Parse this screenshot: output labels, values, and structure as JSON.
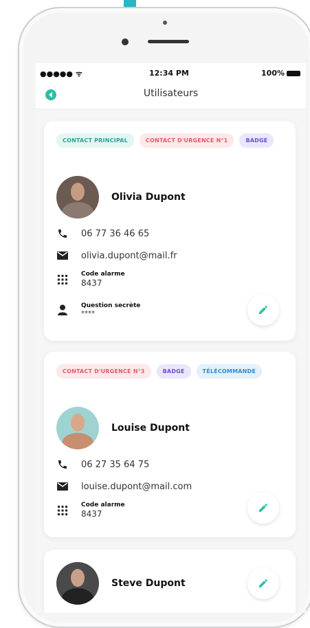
{
  "status_bar": {
    "signal": "●●●●● ᯤ",
    "time": "12:34 PM",
    "battery": "100%"
  },
  "nav": {
    "title": "Utilisateurs"
  },
  "users": [
    {
      "tags": [
        "CONTACT PRINCIPAL",
        "CONTACT D'URGENCE N°1",
        "BADGE"
      ],
      "name": "Olivia Dupont",
      "phone": "06 77 36 46 65",
      "email": "olivia.dupont@mail.fr",
      "alarm_label": "Code alarme",
      "alarm_code": "8437",
      "question_label": "Question secrète",
      "question_value": "****"
    },
    {
      "tags": [
        "CONTACT D'URGENCE N°3",
        "BADGE",
        "TÉLÉCOMMANDE"
      ],
      "name": "Louise Dupont",
      "phone": "06 27 35 64 75",
      "email": "louise.dupont@mail.com",
      "alarm_label": "Code alarme",
      "alarm_code": "8437"
    },
    {
      "name": "Steve Dupont"
    }
  ],
  "colors": {
    "accent": "#2bbfa8",
    "tag_green": "#2aa593",
    "tag_red": "#e45a6a",
    "tag_purple": "#6b4ed1",
    "tag_blue": "#2d8bd0"
  }
}
